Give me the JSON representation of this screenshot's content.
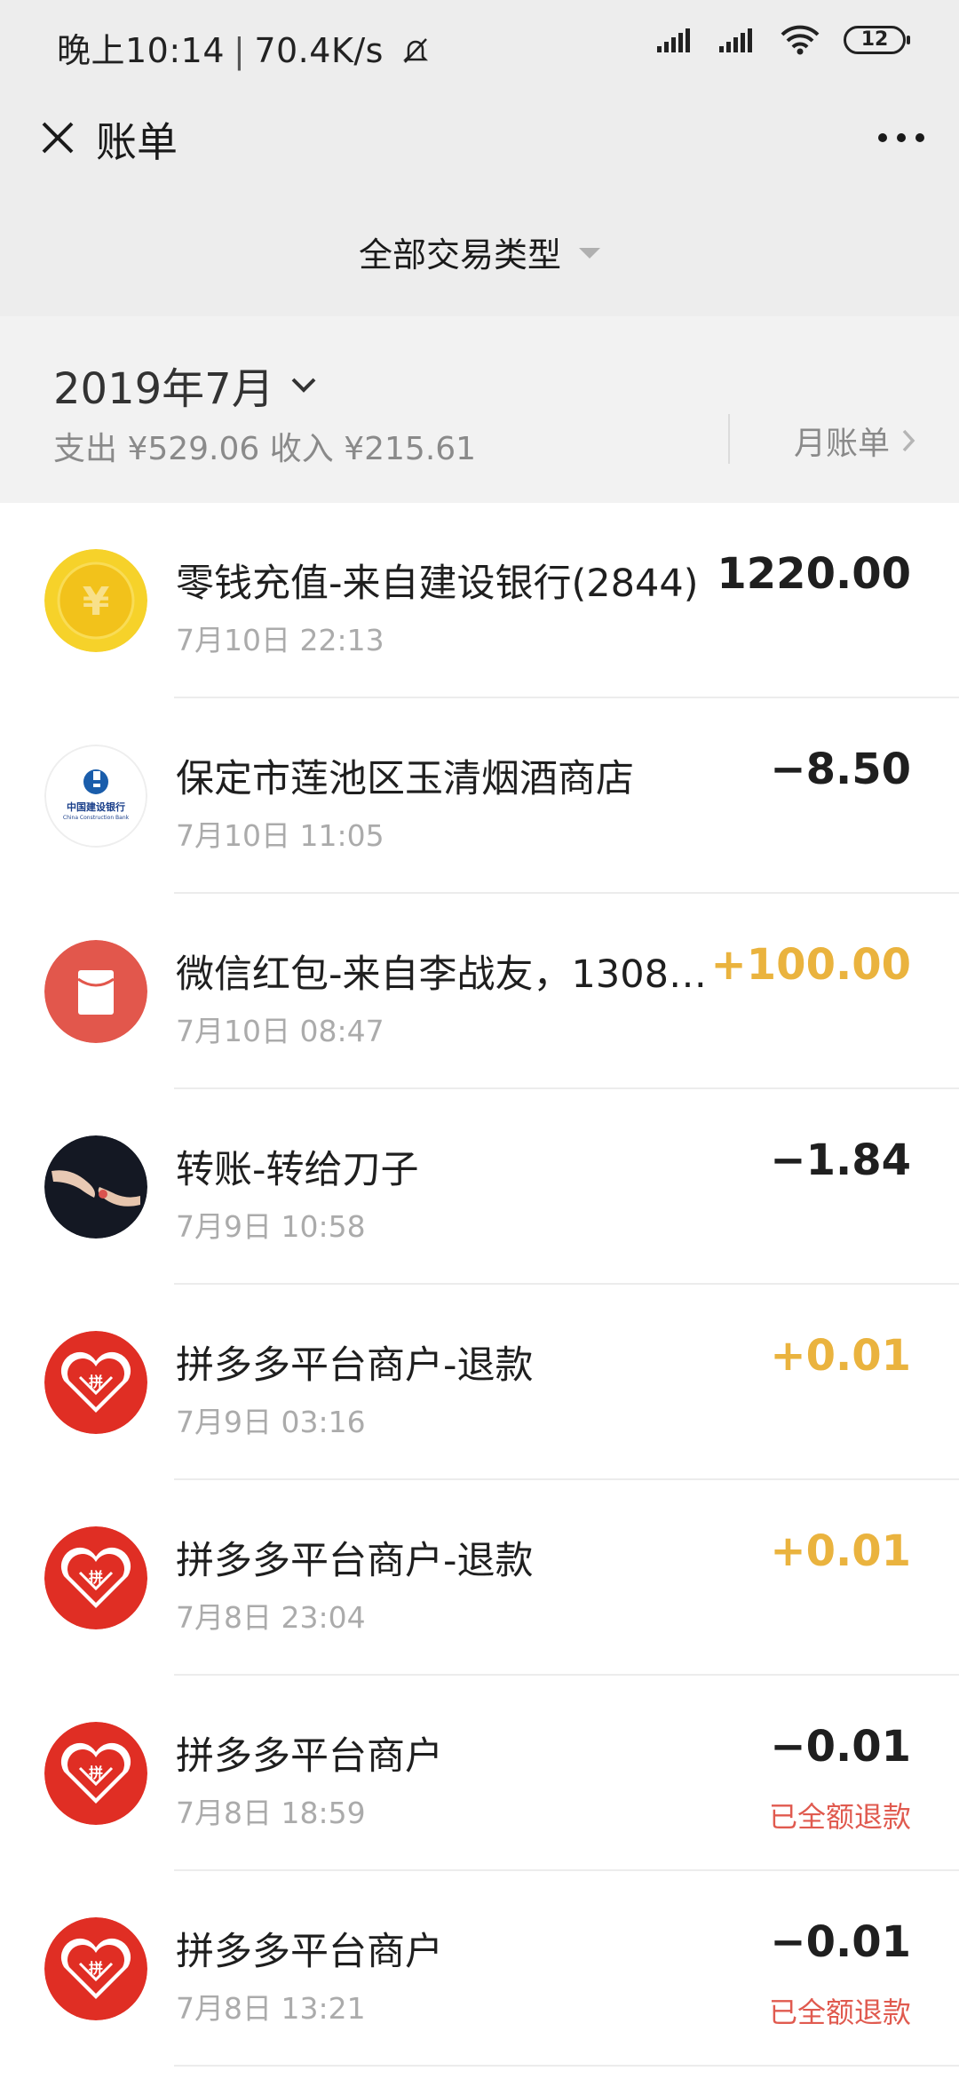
{
  "status_bar": {
    "time": "晚上10:14",
    "net_speed": "70.4K/s",
    "battery": "12",
    "icons": [
      "mute-bell-icon",
      "signal-icon",
      "signal-icon",
      "wifi-icon",
      "battery-icon"
    ]
  },
  "header": {
    "title": "账单"
  },
  "filter": {
    "label": "全部交易类型"
  },
  "month_header": {
    "month": "2019年7月",
    "summary": "支出 ¥529.06 收入 ¥215.61",
    "monthly_bill_label": "月账单"
  },
  "colors": {
    "positive_amount": "#eab33e",
    "refund_status": "#e05a4f",
    "header_bg": "#ededed",
    "month_bg": "#f2f2f2"
  },
  "transactions": [
    {
      "title": "零钱充值-来自建设银行(2844)",
      "time": "7月10日 22:13",
      "amount": "1220.00",
      "status": "",
      "icon": "coin-yen-icon"
    },
    {
      "title": "保定市莲池区玉清烟酒商店",
      "time": "7月10日 11:05",
      "amount": "−8.50",
      "status": "",
      "icon": "ccb-bank-logo"
    },
    {
      "title": "微信红包-来自李战友，13082…",
      "time": "7月10日 08:47",
      "amount": "+100.00",
      "status": "",
      "icon": "red-packet-icon"
    },
    {
      "title": "转账-转给刀子",
      "time": "7月9日 10:58",
      "amount": "−1.84",
      "status": "",
      "icon": "user-photo-avatar"
    },
    {
      "title": "拼多多平台商户-退款",
      "time": "7月9日 03:16",
      "amount": "+0.01",
      "status": "",
      "icon": "pinduoduo-logo"
    },
    {
      "title": "拼多多平台商户-退款",
      "time": "7月8日 23:04",
      "amount": "+0.01",
      "status": "",
      "icon": "pinduoduo-logo"
    },
    {
      "title": "拼多多平台商户",
      "time": "7月8日 18:59",
      "amount": "−0.01",
      "status": "已全额退款",
      "icon": "pinduoduo-logo"
    },
    {
      "title": "拼多多平台商户",
      "time": "7月8日 13:21",
      "amount": "−0.01",
      "status": "已全额退款",
      "icon": "pinduoduo-logo"
    }
  ]
}
